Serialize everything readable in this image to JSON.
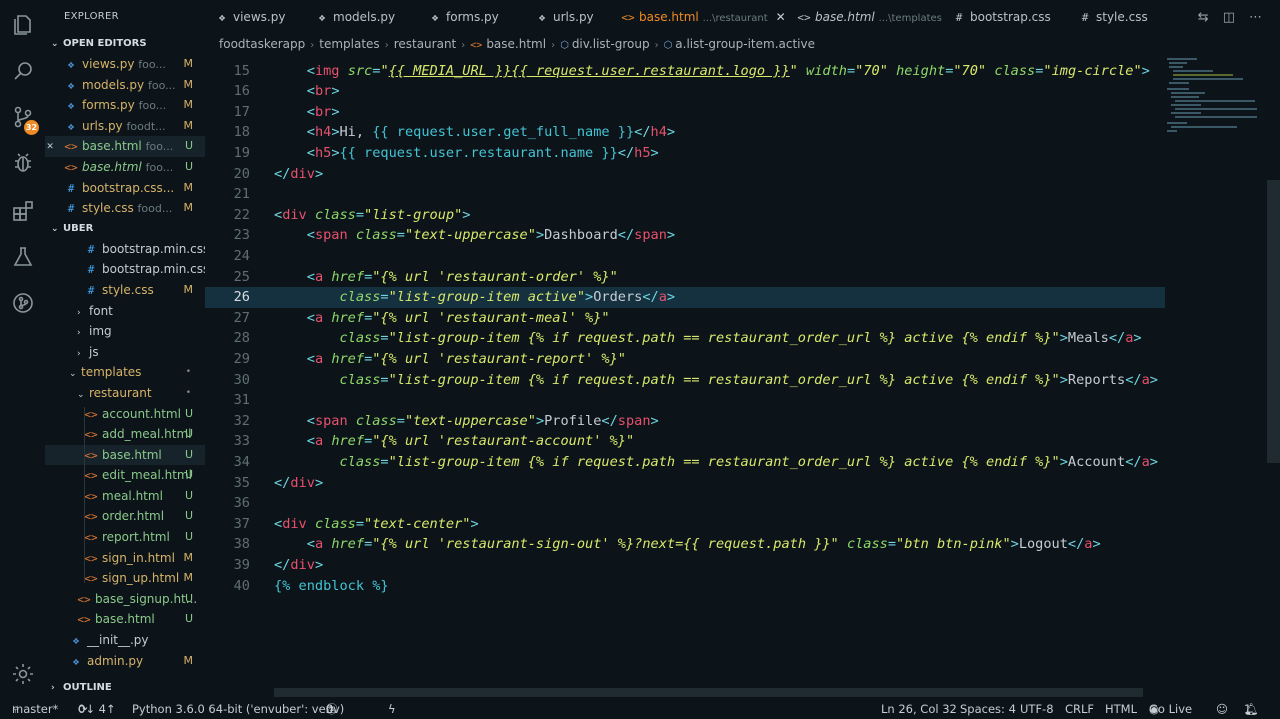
{
  "activity_bar": {
    "items": [
      {
        "name": "explorer-icon"
      },
      {
        "name": "search-icon"
      },
      {
        "name": "source-control-icon",
        "badge": "32"
      },
      {
        "name": "debug-icon"
      },
      {
        "name": "extensions-icon"
      },
      {
        "name": "test-flask-icon"
      },
      {
        "name": "git-graph-icon"
      },
      {
        "name": "settings-gear-icon"
      }
    ]
  },
  "sidebar": {
    "title": "EXPLORER",
    "open_editors": {
      "label": "OPEN EDITORS",
      "items": [
        {
          "name": "views.py",
          "path": "foo...",
          "status": "M",
          "type": "py"
        },
        {
          "name": "models.py",
          "path": "foo...",
          "status": "M",
          "type": "py"
        },
        {
          "name": "forms.py",
          "path": "foo...",
          "status": "M",
          "type": "py"
        },
        {
          "name": "urls.py",
          "path": "foodt...",
          "status": "M",
          "type": "py"
        },
        {
          "name": "base.html",
          "path": "foo...",
          "status": "U",
          "type": "html"
        },
        {
          "name": "base.html",
          "path": "foo...",
          "status": "U",
          "type": "html"
        },
        {
          "name": "bootstrap.css...",
          "path": "",
          "status": "M",
          "type": "css"
        },
        {
          "name": "style.css",
          "path": "food...",
          "status": "M",
          "type": "css"
        }
      ]
    },
    "project": {
      "label": "UBER",
      "items": [
        {
          "name": "bootstrap.min.css",
          "status": "",
          "type": "css"
        },
        {
          "name": "bootstrap.min.css...",
          "status": "",
          "type": "css"
        },
        {
          "name": "style.css",
          "status": "M",
          "type": "css"
        },
        {
          "name": "font",
          "status": "",
          "type": "folder"
        },
        {
          "name": "img",
          "status": "",
          "type": "folder"
        },
        {
          "name": "js",
          "status": "",
          "type": "folder"
        },
        {
          "name": "templates",
          "status": "•",
          "type": "folder-open"
        },
        {
          "name": "restaurant",
          "status": "•",
          "type": "folder-open"
        },
        {
          "name": "account.html",
          "status": "U",
          "type": "html"
        },
        {
          "name": "add_meal.html",
          "status": "U",
          "type": "html"
        },
        {
          "name": "base.html",
          "status": "U",
          "type": "html"
        },
        {
          "name": "edit_meal.html",
          "status": "U",
          "type": "html"
        },
        {
          "name": "meal.html",
          "status": "U",
          "type": "html"
        },
        {
          "name": "order.html",
          "status": "U",
          "type": "html"
        },
        {
          "name": "report.html",
          "status": "U",
          "type": "html"
        },
        {
          "name": "sign_in.html",
          "status": "M",
          "type": "html"
        },
        {
          "name": "sign_up.html",
          "status": "M",
          "type": "html"
        },
        {
          "name": "base_signup.ht...",
          "status": "U",
          "type": "html"
        },
        {
          "name": "base.html",
          "status": "U",
          "type": "html"
        },
        {
          "name": "__init__.py",
          "status": "",
          "type": "py"
        },
        {
          "name": "admin.py",
          "status": "M",
          "type": "py"
        }
      ]
    },
    "outline_label": "OUTLINE"
  },
  "tabs": [
    {
      "label": "views.py",
      "sub": "",
      "type": "py"
    },
    {
      "label": "models.py",
      "sub": "",
      "type": "py"
    },
    {
      "label": "forms.py",
      "sub": "",
      "type": "py"
    },
    {
      "label": "urls.py",
      "sub": "",
      "type": "py"
    },
    {
      "label": "base.html",
      "sub": "...\\restaurant",
      "type": "html",
      "active": true
    },
    {
      "label": "base.html",
      "sub": "...\\templates",
      "type": "html"
    },
    {
      "label": "bootstrap.css",
      "sub": "",
      "type": "css"
    },
    {
      "label": "style.css",
      "sub": "",
      "type": "css"
    }
  ],
  "breadcrumbs": [
    "foodtaskerapp",
    "templates",
    "restaurant",
    "base.html",
    "div.list-group",
    "a.list-group-item.active"
  ],
  "editor": {
    "current_line": 26,
    "lines": [
      {
        "n": "15",
        "indent": 1,
        "html": "<span class='p'>&lt;</span><span class='t'>img</span> <span class='a'>src</span><span class='p'>=</span><span class='s'>\"<u>{{ MEDIA_URL }}{{ request.user.restaurant.logo }}</u>\"</span> <span class='a'>width</span><span class='p'>=</span><span class='s'>\"70\"</span> <span class='a'>height</span><span class='p'>=</span><span class='s'>\"70\"</span> <span class='a'>class</span><span class='p'>=</span><span class='s'>\"img-circle\"</span><span class='p'>&gt;</span>"
      },
      {
        "n": "16",
        "indent": 1,
        "html": "<span class='p'>&lt;</span><span class='t'>br</span><span class='p'>&gt;</span>"
      },
      {
        "n": "17",
        "indent": 1,
        "html": "<span class='p'>&lt;</span><span class='t'>br</span><span class='p'>&gt;</span>"
      },
      {
        "n": "18",
        "indent": 1,
        "html": "<span class='p'>&lt;</span><span class='t'>h4</span><span class='p'>&gt;</span><span class='txt'>Hi, </span><span class='tl'>{{ request.user.get_full_name }}</span><span class='p'>&lt;/</span><span class='t'>h4</span><span class='p'>&gt;</span>"
      },
      {
        "n": "19",
        "indent": 1,
        "html": "<span class='p'>&lt;</span><span class='t'>h5</span><span class='p'>&gt;</span><span class='tl'>{{ request.user.restaurant.name }}</span><span class='p'>&lt;/</span><span class='t'>h5</span><span class='p'>&gt;</span>"
      },
      {
        "n": "20",
        "indent": 0,
        "html": "<span class='p'>&lt;/</span><span class='t'>div</span><span class='p'>&gt;</span>"
      },
      {
        "n": "21",
        "indent": 0,
        "html": ""
      },
      {
        "n": "22",
        "indent": 0,
        "html": "<span class='p'>&lt;</span><span class='t'>div</span> <span class='a'>class</span><span class='p'>=</span><span class='s'>\"list-group\"</span><span class='p'>&gt;</span>"
      },
      {
        "n": "23",
        "indent": 1,
        "html": "<span class='p'>&lt;</span><span class='t'>span</span> <span class='a'>class</span><span class='p'>=</span><span class='s'>\"text-uppercase\"</span><span class='p'>&gt;</span><span class='txt'>Dashboard</span><span class='p'>&lt;/</span><span class='t'>span</span><span class='p'>&gt;</span>"
      },
      {
        "n": "24",
        "indent": 0,
        "html": ""
      },
      {
        "n": "25",
        "indent": 1,
        "html": "<span class='p'>&lt;</span><span class='t'>a</span> <span class='a'>href</span><span class='p'>=</span><span class='s'>\"{% url 'restaurant-order' %}\"</span>"
      },
      {
        "n": "26",
        "indent": 2,
        "html": "<span class='a'>class</span><span class='p'>=</span><span class='s'>\"list-group-item active\"</span><span class='p'>&gt;</span><span class='txt'>Orders</span><span class='p'>&lt;/</span><span class='t'>a</span><span class='p'>&gt;</span>"
      },
      {
        "n": "27",
        "indent": 1,
        "html": "<span class='p'>&lt;</span><span class='t'>a</span> <span class='a'>href</span><span class='p'>=</span><span class='s'>\"{% url 'restaurant-meal' %}\"</span>"
      },
      {
        "n": "28",
        "indent": 2,
        "html": "<span class='a'>class</span><span class='p'>=</span><span class='s'>\"list-group-item {% if request.path == restaurant_order_url %} active {% endif %}\"</span><span class='p'>&gt;</span><span class='txt'>Meals</span><span class='p'>&lt;/</span><span class='t'>a</span><span class='p'>&gt;</span>"
      },
      {
        "n": "29",
        "indent": 1,
        "html": "<span class='p'>&lt;</span><span class='t'>a</span> <span class='a'>href</span><span class='p'>=</span><span class='s'>\"{% url 'restaurant-report' %}\"</span>"
      },
      {
        "n": "30",
        "indent": 2,
        "html": "<span class='a'>class</span><span class='p'>=</span><span class='s'>\"list-group-item {% if request.path == restaurant_order_url %} active {% endif %}\"</span><span class='p'>&gt;</span><span class='txt'>Reports</span><span class='p'>&lt;/</span><span class='t'>a</span><span class='p'>&gt;</span>"
      },
      {
        "n": "31",
        "indent": 0,
        "html": ""
      },
      {
        "n": "32",
        "indent": 1,
        "html": "<span class='p'>&lt;</span><span class='t'>span</span> <span class='a'>class</span><span class='p'>=</span><span class='s'>\"text-uppercase\"</span><span class='p'>&gt;</span><span class='txt'>Profile</span><span class='p'>&lt;/</span><span class='t'>span</span><span class='p'>&gt;</span>"
      },
      {
        "n": "33",
        "indent": 1,
        "html": "<span class='p'>&lt;</span><span class='t'>a</span> <span class='a'>href</span><span class='p'>=</span><span class='s'>\"{% url 'restaurant-account' %}\"</span>"
      },
      {
        "n": "34",
        "indent": 2,
        "html": "<span class='a'>class</span><span class='p'>=</span><span class='s'>\"list-group-item {% if request.path == restaurant_order_url %} active {% endif %}\"</span><span class='p'>&gt;</span><span class='txt'>Account</span><span class='p'>&lt;/</span><span class='t'>a</span><span class='p'>&gt;</span>"
      },
      {
        "n": "35",
        "indent": 0,
        "html": "<span class='p'>&lt;/</span><span class='t'>div</span><span class='p'>&gt;</span>"
      },
      {
        "n": "36",
        "indent": 0,
        "html": ""
      },
      {
        "n": "37",
        "indent": 0,
        "html": "<span class='p'>&lt;</span><span class='t'>div</span> <span class='a'>class</span><span class='p'>=</span><span class='s'>\"text-center\"</span><span class='p'>&gt;</span>"
      },
      {
        "n": "38",
        "indent": 1,
        "html": "<span class='p'>&lt;</span><span class='t'>a</span> <span class='a'>href</span><span class='p'>=</span><span class='s'>\"{% url 'restaurant-sign-out' %}?next={{ request.path }}\"</span> <span class='a'>class</span><span class='p'>=</span><span class='s'>\"btn btn-pink\"</span><span class='p'>&gt;</span><span class='txt'>Logout</span><span class='p'>&lt;/</span><span class='t'>a</span><span class='p'>&gt;</span>"
      },
      {
        "n": "39",
        "indent": 0,
        "html": "<span class='p'>&lt;/</span><span class='t'>div</span><span class='p'>&gt;</span>"
      },
      {
        "n": "40",
        "indent": 0,
        "html": "<span class='tl'>{% endblock %}</span>"
      }
    ]
  },
  "status_bar": {
    "branch": "master*",
    "sync": "0↓ 4↑",
    "python": "Python 3.6.0 64-bit ('envuber': venv)",
    "errors": "0",
    "warnings": "0",
    "cursor": "Ln 26, Col 32",
    "spaces": "Spaces: 4",
    "encoding": "UTF-8",
    "eol": "CRLF",
    "language": "HTML",
    "go_live": "Go Live",
    "notifications": "1"
  },
  "colors": {
    "background": "#0c1419",
    "active_tab": "#f08a24",
    "modified": "#d7b36a",
    "untracked": "#8bc88b",
    "tag": "#e8506d",
    "string": "#d8e86b"
  }
}
